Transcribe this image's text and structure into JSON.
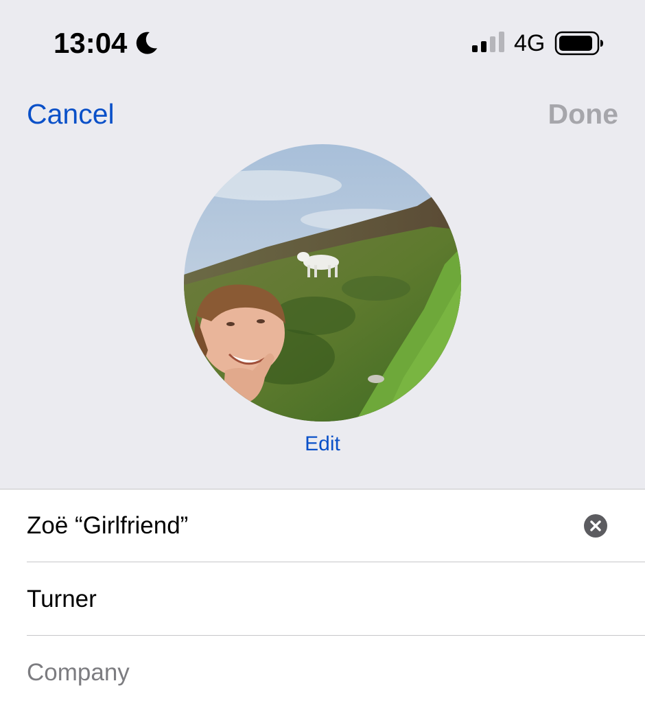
{
  "status_bar": {
    "time": "13:04",
    "network": "4G",
    "icons": [
      "moon-icon",
      "cellular-signal-icon",
      "battery-icon"
    ]
  },
  "nav": {
    "cancel_label": "Cancel",
    "done_label": "Done"
  },
  "photo": {
    "edit_label": "Edit"
  },
  "fields": {
    "first_name": {
      "value": "Zoë “Girlfriend”",
      "clear_icon": "clear-circle-icon"
    },
    "last_name": {
      "value": "Turner"
    },
    "company": {
      "placeholder": "Company"
    }
  },
  "colors": {
    "accent": "#0a50c8",
    "disabled": "#a6a6ab",
    "background": "#ebebf0",
    "placeholder": "#7c7c80"
  }
}
